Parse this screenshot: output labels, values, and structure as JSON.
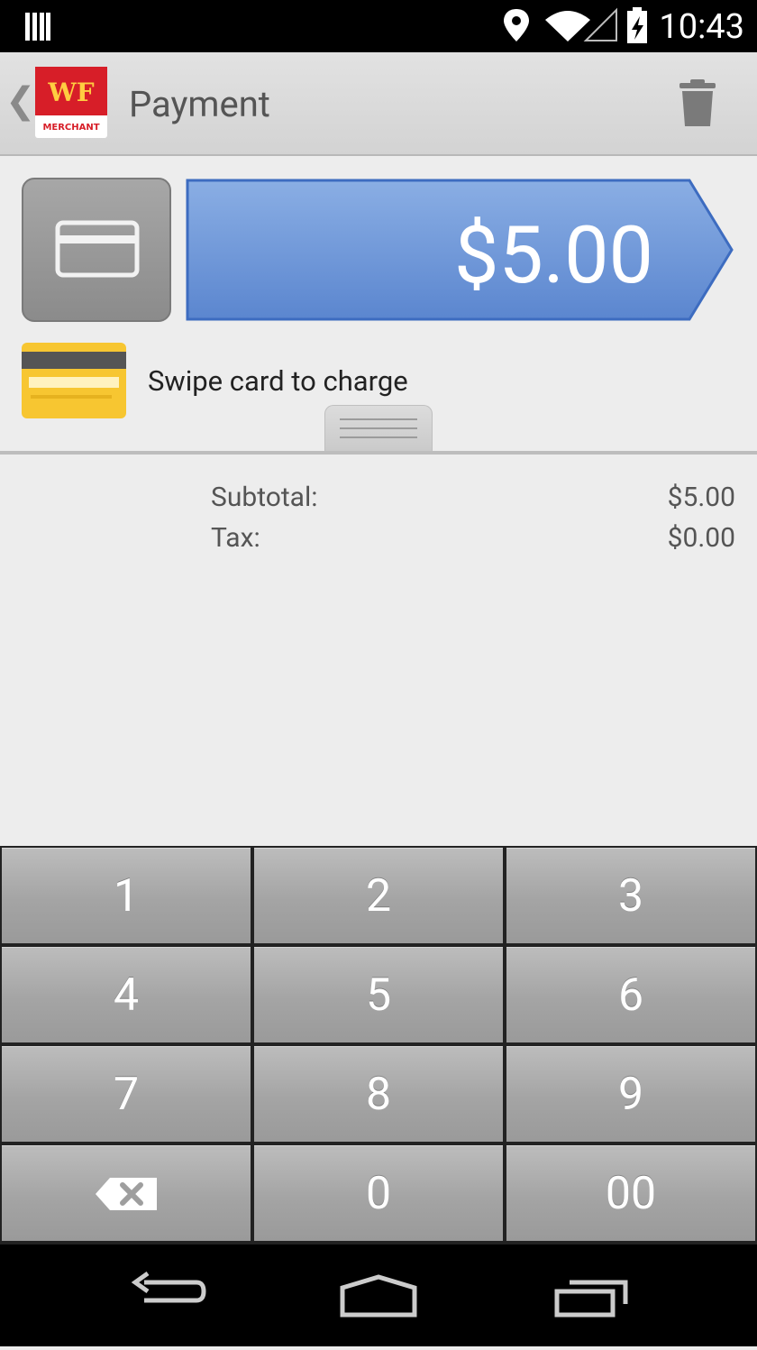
{
  "status_bar": {
    "time": "10:43",
    "icons": [
      "notifications-icon",
      "location-icon",
      "wifi-icon",
      "signal-icon",
      "battery-charging-icon"
    ]
  },
  "action_bar": {
    "back_icon": "chevron-left-icon",
    "logo": {
      "top_text": "WF",
      "bottom_text": "MERCHANT",
      "color": "#d71e28",
      "text_color": "#ffcd41"
    },
    "title": "Payment",
    "delete_icon": "trash-icon"
  },
  "payment": {
    "amount": "$5.00",
    "amount_color": "#5d88cf",
    "card_button_icon": "credit-card-icon",
    "swipe_prompt": "Swipe card to charge",
    "swipe_card_icon": "card-swipe-icon"
  },
  "summary": {
    "subtotal_label": "Subtotal:",
    "subtotal_value": "$5.00",
    "tax_label": "Tax:",
    "tax_value": "$0.00"
  },
  "keypad": {
    "keys": [
      "1",
      "2",
      "3",
      "4",
      "5",
      "6",
      "7",
      "8",
      "9",
      "",
      "0",
      "00"
    ],
    "backspace_icon": "backspace-icon"
  },
  "nav_bar": {
    "icons": [
      "back-icon",
      "home-icon",
      "recent-apps-icon"
    ]
  }
}
